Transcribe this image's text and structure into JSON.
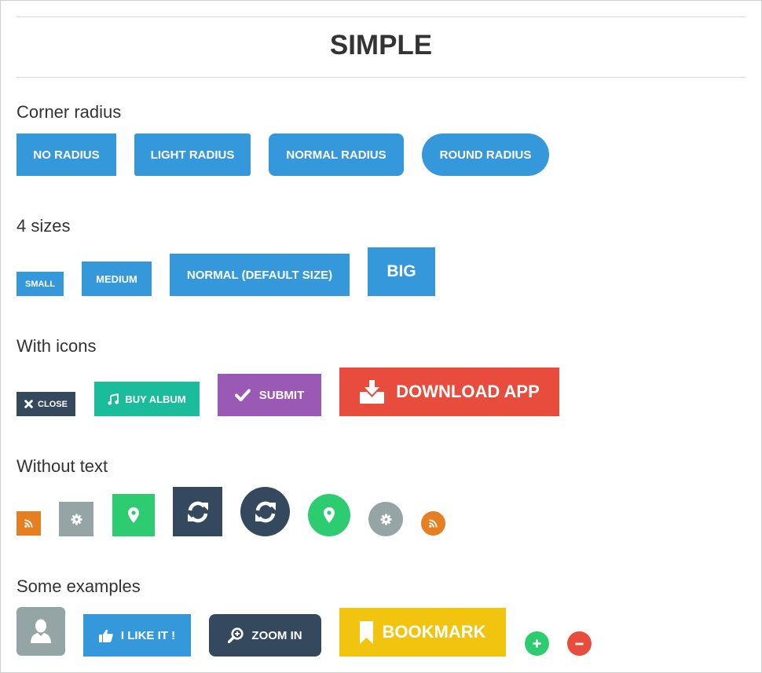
{
  "header": {
    "title": "SIMPLE"
  },
  "sections": {
    "corner_radius": {
      "label": "Corner radius",
      "buttons": [
        "NO RADIUS",
        "LIGHT RADIUS",
        "NORMAL RADIUS",
        "ROUND RADIUS"
      ]
    },
    "sizes": {
      "label": "4 sizes",
      "buttons": [
        "SMALL",
        "MEDIUM",
        "NORMAL (DEFAULT SIZE)",
        "BIG"
      ]
    },
    "with_icons": {
      "label": "With icons",
      "buttons": [
        {
          "label": "CLOSE",
          "icon": "close-icon"
        },
        {
          "label": "BUY ALBUM",
          "icon": "music-icon"
        },
        {
          "label": "SUBMIT",
          "icon": "check-icon"
        },
        {
          "label": "DOWNLOAD APP",
          "icon": "download-icon"
        }
      ]
    },
    "without_text": {
      "label": "Without text",
      "icons": [
        "rss-icon",
        "gear-icon",
        "map-marker-icon",
        "refresh-icon",
        "refresh-icon",
        "map-marker-icon",
        "gear-icon",
        "rss-icon"
      ]
    },
    "examples": {
      "label": "Some examples",
      "buttons": [
        {
          "label": "",
          "icon": "user-icon"
        },
        {
          "label": "I LIKE IT !",
          "icon": "thumbs-up-icon"
        },
        {
          "label": "ZOOM IN",
          "icon": "zoom-in-icon"
        },
        {
          "label": "BOOKMARK",
          "icon": "bookmark-icon"
        },
        {
          "label": "",
          "icon": "plus-icon"
        },
        {
          "label": "",
          "icon": "minus-icon"
        }
      ]
    }
  },
  "colors": {
    "blue": "#3498db",
    "dark": "#34495e",
    "teal": "#1abc9c",
    "purple": "#9b59b6",
    "red": "#e74c3c",
    "orange": "#e67e22",
    "gray": "#95a5a6",
    "green": "#2ecc71",
    "yellow": "#f1c40f"
  }
}
